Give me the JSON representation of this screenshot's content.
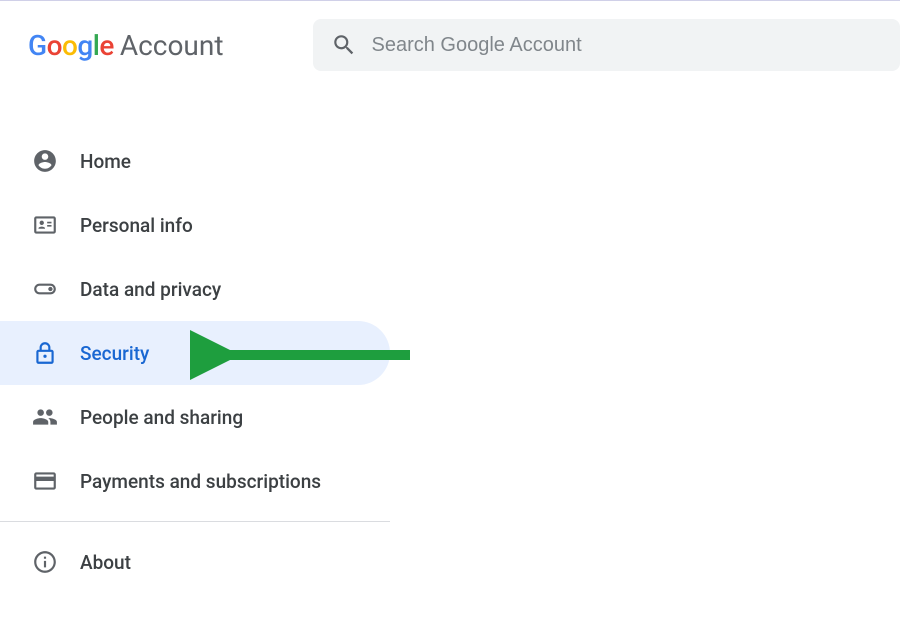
{
  "header": {
    "brand": "Google",
    "product": "Account",
    "search_placeholder": "Search Google Account"
  },
  "sidebar": {
    "items": [
      {
        "label": "Home",
        "active": false
      },
      {
        "label": "Personal info",
        "active": false
      },
      {
        "label": "Data and privacy",
        "active": false
      },
      {
        "label": "Security",
        "active": true
      },
      {
        "label": "People and sharing",
        "active": false
      },
      {
        "label": "Payments and subscriptions",
        "active": false
      }
    ],
    "footer_items": [
      {
        "label": "About"
      }
    ]
  },
  "annotations": {
    "arrow_color": "#1E9E3E"
  }
}
